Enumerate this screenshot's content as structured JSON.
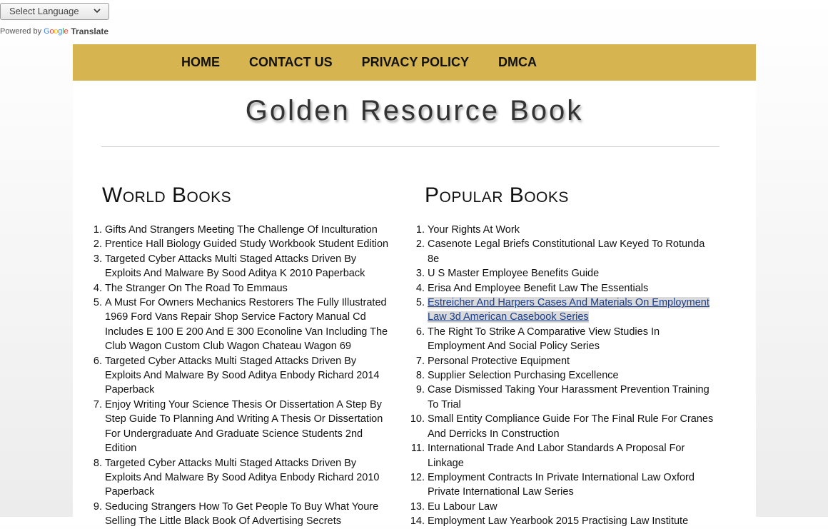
{
  "translate": {
    "select_label": "Select Language",
    "powered_by": "Powered by",
    "google": "Google",
    "translate": "Translate"
  },
  "nav": {
    "items": [
      {
        "label": "HOME"
      },
      {
        "label": "CONTACT US"
      },
      {
        "label": "PRIVACY POLICY"
      },
      {
        "label": "DMCA"
      }
    ]
  },
  "site_title": "Golden Resource Book",
  "world_books": {
    "heading": "World Books",
    "items": [
      "Gifts And Strangers Meeting The Challenge Of Inculturation",
      "Prentice Hall Biology Guided Study Workbook Student Edition",
      "Targeted Cyber Attacks Multi Staged Attacks Driven By Exploits And Malware By Sood Aditya K 2010 Paperback",
      "The Stranger On The Road To Emmaus",
      "A Must For Owners Mechanics Restorers The Fully Illustrated 1969 Ford Vans Repair Shop Service Factory Manual Cd Includes E 100 E 200 And E 300 Econoline Van Including The Club Wagon Custom Club Wagon Chateau Wagon 69",
      "Targeted Cyber Attacks Multi Staged Attacks Driven By Exploits And Malware By Sood Aditya Enbody Richard 2014 Paperback",
      "Enjoy Writing Your Science Thesis Or Dissertation A Step By Step Guide To Planning And Writing A Thesis Or Dissertation For Undergraduate And Graduate Science Students 2nd Edition",
      "Targeted Cyber Attacks Multi Staged Attacks Driven By Exploits And Malware By Sood Aditya Enbody Richard 2010 Paperback",
      "Seducing Strangers How To Get People To Buy What Youre Selling The Little Black Book Of Advertising Secrets"
    ]
  },
  "popular_books": {
    "heading": "Popular Books",
    "highlighted_index": 4,
    "items": [
      "Your Rights At Work",
      "Casenote Legal Briefs Constitutional Law Keyed To Rotunda 8e",
      "U S Master Employee Benefits Guide",
      "Erisa And Employee Benefit Law The Essentials",
      "Estreicher And Harpers Cases And Materials On Employment Law 3d American Casebook Series",
      "The Right To Strike A Comparative View Studies In Employment And Social Policy Series",
      "Personal Protective Equipment",
      "Supplier Selection Purchasing Excellence",
      "Case Dismissed Taking Your Harassment Prevention Training To Trial",
      "Small Entity Compliance Guide For The Final Rule For Cranes And Derricks In Construction",
      "International Trade And Labor Standards A Proposal For Linkage",
      "Employment Contracts In Private International Law Oxford Private International Law Series",
      "Eu Labour Law",
      "Employment Law Yearbook 2015 Practising Law Institute"
    ]
  },
  "colors": {
    "nav_bg": "#d6b450",
    "link": "#1a3e8c"
  }
}
